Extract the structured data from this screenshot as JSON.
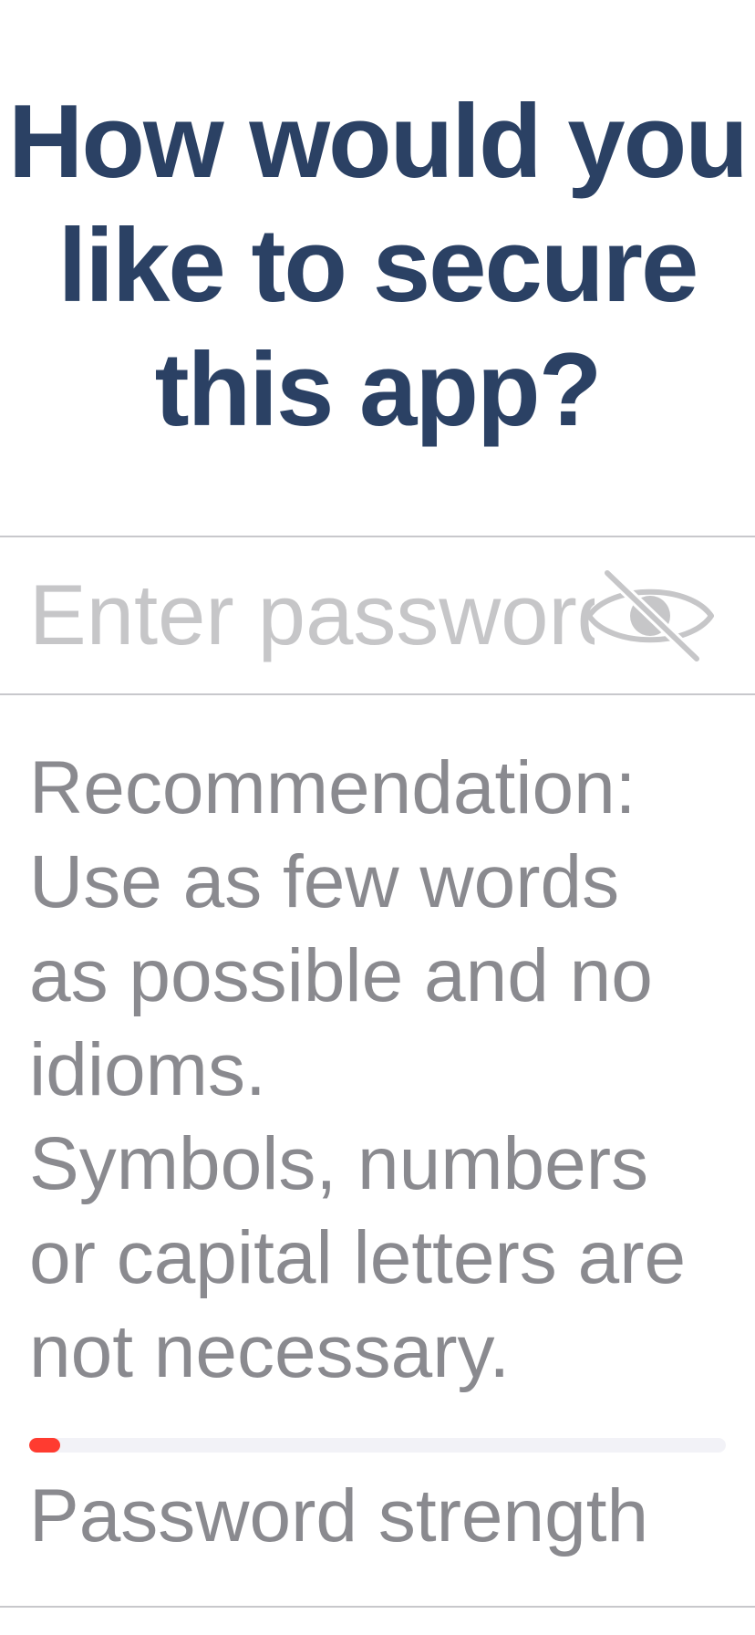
{
  "header": {
    "title_lines": [
      "How would you",
      "like to secure",
      "this app?"
    ]
  },
  "password_input": {
    "value": "",
    "placeholder": "Enter password",
    "visibility_icon": "eye-slash-icon"
  },
  "recommendation": {
    "text": "Recommendation:\nUse as few words\nas possible and no\nidioms.\n Symbols, numbers\nor capital letters are\nnot necessary."
  },
  "strength": {
    "level_fraction": 0.045,
    "fill_color": "#ff3b30",
    "track_color": "#f2f2f7",
    "label": "Password strength"
  },
  "colors": {
    "title": "#2b4164",
    "secondary_text": "#8a8a8f",
    "placeholder": "#c6c6c8",
    "divider": "#c8c8cc"
  }
}
